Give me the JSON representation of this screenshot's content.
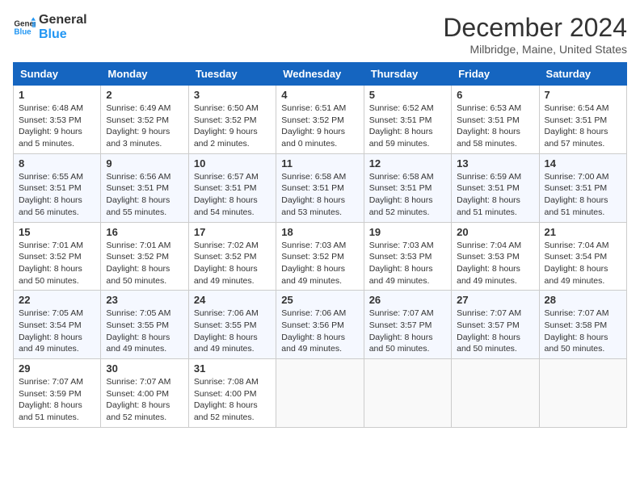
{
  "header": {
    "logo_line1": "General",
    "logo_line2": "Blue",
    "title": "December 2024",
    "subtitle": "Milbridge, Maine, United States"
  },
  "weekdays": [
    "Sunday",
    "Monday",
    "Tuesday",
    "Wednesday",
    "Thursday",
    "Friday",
    "Saturday"
  ],
  "weeks": [
    [
      {
        "day": "1",
        "sunrise": "Sunrise: 6:48 AM",
        "sunset": "Sunset: 3:53 PM",
        "daylight": "Daylight: 9 hours and 5 minutes."
      },
      {
        "day": "2",
        "sunrise": "Sunrise: 6:49 AM",
        "sunset": "Sunset: 3:52 PM",
        "daylight": "Daylight: 9 hours and 3 minutes."
      },
      {
        "day": "3",
        "sunrise": "Sunrise: 6:50 AM",
        "sunset": "Sunset: 3:52 PM",
        "daylight": "Daylight: 9 hours and 2 minutes."
      },
      {
        "day": "4",
        "sunrise": "Sunrise: 6:51 AM",
        "sunset": "Sunset: 3:52 PM",
        "daylight": "Daylight: 9 hours and 0 minutes."
      },
      {
        "day": "5",
        "sunrise": "Sunrise: 6:52 AM",
        "sunset": "Sunset: 3:51 PM",
        "daylight": "Daylight: 8 hours and 59 minutes."
      },
      {
        "day": "6",
        "sunrise": "Sunrise: 6:53 AM",
        "sunset": "Sunset: 3:51 PM",
        "daylight": "Daylight: 8 hours and 58 minutes."
      },
      {
        "day": "7",
        "sunrise": "Sunrise: 6:54 AM",
        "sunset": "Sunset: 3:51 PM",
        "daylight": "Daylight: 8 hours and 57 minutes."
      }
    ],
    [
      {
        "day": "8",
        "sunrise": "Sunrise: 6:55 AM",
        "sunset": "Sunset: 3:51 PM",
        "daylight": "Daylight: 8 hours and 56 minutes."
      },
      {
        "day": "9",
        "sunrise": "Sunrise: 6:56 AM",
        "sunset": "Sunset: 3:51 PM",
        "daylight": "Daylight: 8 hours and 55 minutes."
      },
      {
        "day": "10",
        "sunrise": "Sunrise: 6:57 AM",
        "sunset": "Sunset: 3:51 PM",
        "daylight": "Daylight: 8 hours and 54 minutes."
      },
      {
        "day": "11",
        "sunrise": "Sunrise: 6:58 AM",
        "sunset": "Sunset: 3:51 PM",
        "daylight": "Daylight: 8 hours and 53 minutes."
      },
      {
        "day": "12",
        "sunrise": "Sunrise: 6:58 AM",
        "sunset": "Sunset: 3:51 PM",
        "daylight": "Daylight: 8 hours and 52 minutes."
      },
      {
        "day": "13",
        "sunrise": "Sunrise: 6:59 AM",
        "sunset": "Sunset: 3:51 PM",
        "daylight": "Daylight: 8 hours and 51 minutes."
      },
      {
        "day": "14",
        "sunrise": "Sunrise: 7:00 AM",
        "sunset": "Sunset: 3:51 PM",
        "daylight": "Daylight: 8 hours and 51 minutes."
      }
    ],
    [
      {
        "day": "15",
        "sunrise": "Sunrise: 7:01 AM",
        "sunset": "Sunset: 3:52 PM",
        "daylight": "Daylight: 8 hours and 50 minutes."
      },
      {
        "day": "16",
        "sunrise": "Sunrise: 7:01 AM",
        "sunset": "Sunset: 3:52 PM",
        "daylight": "Daylight: 8 hours and 50 minutes."
      },
      {
        "day": "17",
        "sunrise": "Sunrise: 7:02 AM",
        "sunset": "Sunset: 3:52 PM",
        "daylight": "Daylight: 8 hours and 49 minutes."
      },
      {
        "day": "18",
        "sunrise": "Sunrise: 7:03 AM",
        "sunset": "Sunset: 3:52 PM",
        "daylight": "Daylight: 8 hours and 49 minutes."
      },
      {
        "day": "19",
        "sunrise": "Sunrise: 7:03 AM",
        "sunset": "Sunset: 3:53 PM",
        "daylight": "Daylight: 8 hours and 49 minutes."
      },
      {
        "day": "20",
        "sunrise": "Sunrise: 7:04 AM",
        "sunset": "Sunset: 3:53 PM",
        "daylight": "Daylight: 8 hours and 49 minutes."
      },
      {
        "day": "21",
        "sunrise": "Sunrise: 7:04 AM",
        "sunset": "Sunset: 3:54 PM",
        "daylight": "Daylight: 8 hours and 49 minutes."
      }
    ],
    [
      {
        "day": "22",
        "sunrise": "Sunrise: 7:05 AM",
        "sunset": "Sunset: 3:54 PM",
        "daylight": "Daylight: 8 hours and 49 minutes."
      },
      {
        "day": "23",
        "sunrise": "Sunrise: 7:05 AM",
        "sunset": "Sunset: 3:55 PM",
        "daylight": "Daylight: 8 hours and 49 minutes."
      },
      {
        "day": "24",
        "sunrise": "Sunrise: 7:06 AM",
        "sunset": "Sunset: 3:55 PM",
        "daylight": "Daylight: 8 hours and 49 minutes."
      },
      {
        "day": "25",
        "sunrise": "Sunrise: 7:06 AM",
        "sunset": "Sunset: 3:56 PM",
        "daylight": "Daylight: 8 hours and 49 minutes."
      },
      {
        "day": "26",
        "sunrise": "Sunrise: 7:07 AM",
        "sunset": "Sunset: 3:57 PM",
        "daylight": "Daylight: 8 hours and 50 minutes."
      },
      {
        "day": "27",
        "sunrise": "Sunrise: 7:07 AM",
        "sunset": "Sunset: 3:57 PM",
        "daylight": "Daylight: 8 hours and 50 minutes."
      },
      {
        "day": "28",
        "sunrise": "Sunrise: 7:07 AM",
        "sunset": "Sunset: 3:58 PM",
        "daylight": "Daylight: 8 hours and 50 minutes."
      }
    ],
    [
      {
        "day": "29",
        "sunrise": "Sunrise: 7:07 AM",
        "sunset": "Sunset: 3:59 PM",
        "daylight": "Daylight: 8 hours and 51 minutes."
      },
      {
        "day": "30",
        "sunrise": "Sunrise: 7:07 AM",
        "sunset": "Sunset: 4:00 PM",
        "daylight": "Daylight: 8 hours and 52 minutes."
      },
      {
        "day": "31",
        "sunrise": "Sunrise: 7:08 AM",
        "sunset": "Sunset: 4:00 PM",
        "daylight": "Daylight: 8 hours and 52 minutes."
      },
      null,
      null,
      null,
      null
    ]
  ]
}
